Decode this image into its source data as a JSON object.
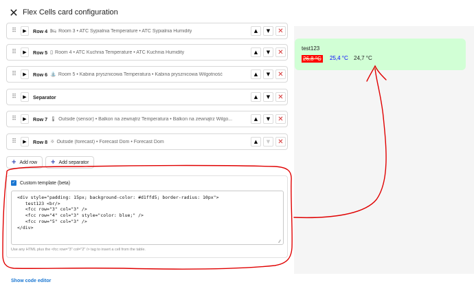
{
  "header": {
    "close_icon": "close-icon",
    "title": "Flex Cells card configuration"
  },
  "rows": [
    {
      "label": "Row 4",
      "icon": "bed-icon",
      "icon_char": "🛏",
      "desc": "Room 3 • ATC Sypialnia Temperature • ATC Sypialnia Humidity",
      "up_disabled": false,
      "down_disabled": false
    },
    {
      "label": "Row 5",
      "icon": "fridge-icon",
      "icon_char": "▯",
      "desc": "Room 4 • ATC Kuchnia Temperature • ATC Kuchnia Humidity",
      "up_disabled": false,
      "down_disabled": false
    },
    {
      "label": "Row 6",
      "icon": "shower-icon",
      "icon_char": "⛲",
      "desc": "Room 5 • Kabina prysznicowa Temperatura • Kabina prysznicowa Wilgotność",
      "up_disabled": false,
      "down_disabled": false
    },
    {
      "label": "Separator",
      "icon": "",
      "icon_char": "",
      "desc": "",
      "up_disabled": false,
      "down_disabled": false
    },
    {
      "label": "Row 7",
      "icon": "thermometer-icon",
      "icon_char": "🌡",
      "desc": "Outside (sensor) • Balkon na zewnątrz Temperatura • Balkon na zewnątrz Wilgo...",
      "up_disabled": false,
      "down_disabled": false
    },
    {
      "label": "Row 8",
      "icon": "weather-sun-icon",
      "icon_char": "☼",
      "desc": "Outside (forecast) • Forecast Dom • Forecast Dom",
      "up_disabled": false,
      "down_disabled": true
    }
  ],
  "buttons": {
    "add_row": "Add row",
    "add_separator": "Add separator"
  },
  "template": {
    "checkbox_label": "Custom template (beta)",
    "checked": true,
    "code": "<div style=\"padding: 15px; background-color: #d1ffd5; border-radius: 10px\">\n   test123 <br/>\n   <fcc row=\"3\" col=\"3\" />\n   <fcc row=\"4\" col=\"3\" style=\"color: blue;\" />\n   <fcc row=\"5\" col=\"3\" />\n</div>",
    "hint": "Use any HTML plus the <fcc row=\"3\" col=\"2\" /> tag to insert a cell from the table."
  },
  "footer": {
    "show_code_editor": "Show code editor"
  },
  "preview": {
    "title": "test123",
    "cells": [
      "26,8 °C",
      "25,4 °C",
      "24,7 °C"
    ],
    "background": "#d1ffd5",
    "cell_1_bg": "#ff0000",
    "cell_2_color": "#0000ff"
  },
  "annotation": {
    "color": "#e00000"
  }
}
